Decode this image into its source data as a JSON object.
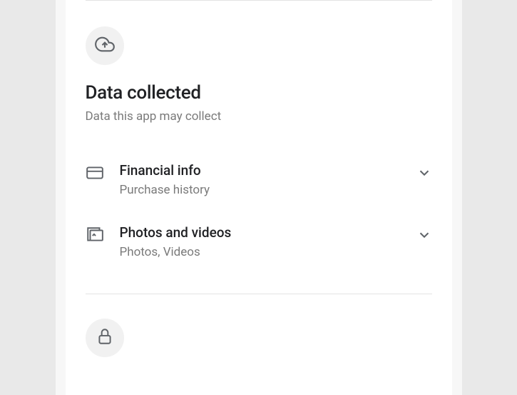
{
  "section": {
    "title": "Data collected",
    "subtitle": "Data this app may collect"
  },
  "items": [
    {
      "title": "Financial info",
      "subtitle": "Purchase history"
    },
    {
      "title": "Photos and videos",
      "subtitle": "Photos, Videos"
    }
  ]
}
